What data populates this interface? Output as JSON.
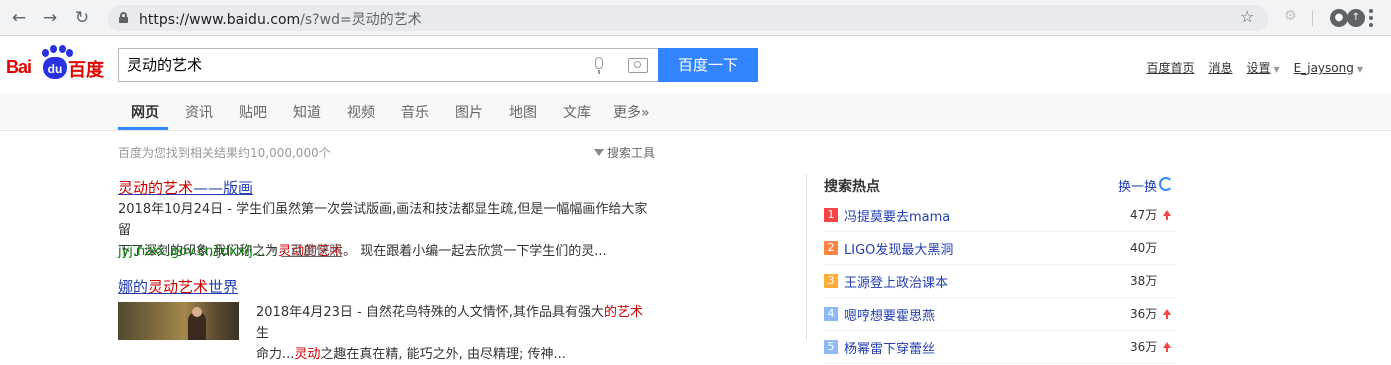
{
  "browser": {
    "url_host": "https://www.baidu.com",
    "url_rest": "/s?wd=灵动的艺术"
  },
  "logo": {
    "bai": "Bai",
    "du": "du",
    "baidu": "百度"
  },
  "search": {
    "query": "灵动的艺术",
    "button_label": "百度一下"
  },
  "top_links": {
    "home": "百度首页",
    "messages": "消息",
    "settings": "设置",
    "user": "E_jaysong"
  },
  "tabs": [
    "网页",
    "资讯",
    "贴吧",
    "知道",
    "视频",
    "音乐",
    "图片",
    "地图",
    "文库",
    "更多»"
  ],
  "active_tab": "网页",
  "result_count": "百度为您找到相关结果约10,000,000个",
  "search_tools": "搜索工具",
  "results": [
    {
      "title_hl": "灵动的艺术",
      "title_rest": "——版画",
      "abstract_1": "2018年10月24日 - 学生们虽然第一次尝试版画,画法和技法都显生疏,但是一幅幅画作给大家留",
      "abstract_2_pre": "下了深刻的印象,我们称之为",
      "abstract_2_hl": "灵动的艺术",
      "abstract_2_post": "。 现在跟着小编一起去欣赏一下学生们的灵...",
      "url": "jyj.hzxc.gov.cn/jdxx/j...",
      "snapshot": "- 百度快照"
    },
    {
      "title_pre": "娜的",
      "title_hl": "灵动艺术",
      "title_rest": "世界",
      "abstract_1_pre": "2018年4月23日 - 自然花鸟特殊的人文情怀,其作品具有强大",
      "abstract_1_hl": "的艺术",
      "abstract_1_post": "生",
      "abstract_2_pre": "命力...",
      "abstract_2_hl": "灵动",
      "abstract_2_post": "之趣在真在精, 能巧之外, 由尽精理; 传神..."
    }
  ],
  "hot": {
    "title": "搜索热点",
    "refresh": "换一换",
    "items": [
      {
        "rank": "1",
        "name": "冯提莫要去mama",
        "count": "47万",
        "rising": true,
        "color": "#f54545"
      },
      {
        "rank": "2",
        "name": "LIGO发现最大黑洞",
        "count": "40万",
        "rising": false,
        "color": "#ff8547"
      },
      {
        "rank": "3",
        "name": "王源登上政治课本",
        "count": "38万",
        "rising": false,
        "color": "#ffac38"
      },
      {
        "rank": "4",
        "name": "嗯哼想要霍思燕",
        "count": "36万",
        "rising": true,
        "color": "#8eb9f5"
      },
      {
        "rank": "5",
        "name": "杨幂雷下穿蕾丝",
        "count": "36万",
        "rising": true,
        "color": "#8eb9f5"
      }
    ]
  }
}
